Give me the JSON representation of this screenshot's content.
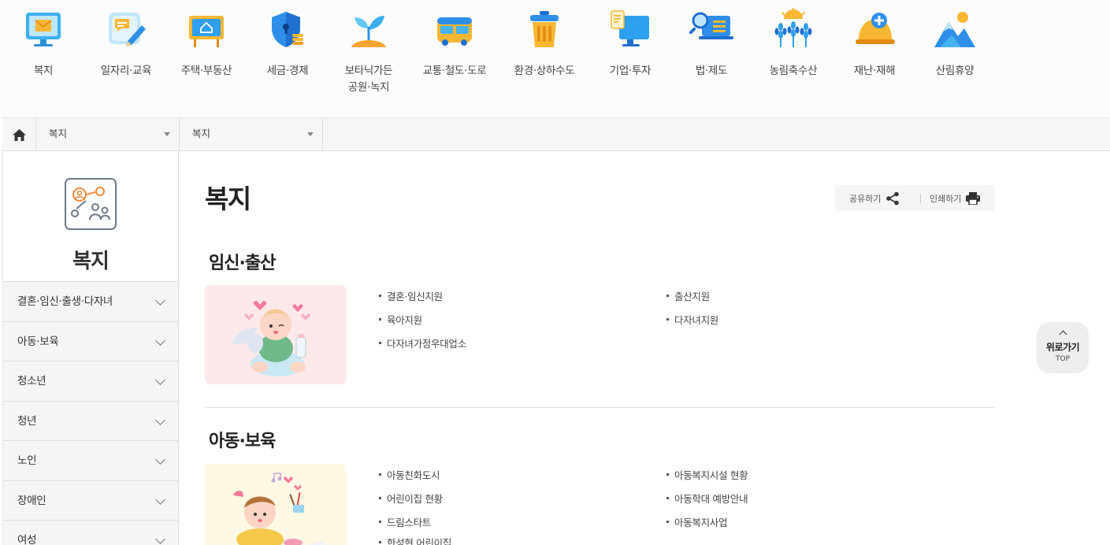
{
  "categories": [
    {
      "label": "복지",
      "icon": "monitor-mail-icon"
    },
    {
      "label": "일자리·교육",
      "icon": "chat-pencil-icon"
    },
    {
      "label": "주택·부동산",
      "icon": "house-sign-icon"
    },
    {
      "label": "세금·경제",
      "icon": "shield-coin-icon"
    },
    {
      "label": "보타닉가든\n공원·녹지",
      "icon": "sprout-icon"
    },
    {
      "label": "교통·철도·도로",
      "icon": "bus-icon"
    },
    {
      "label": "환경·상하수도",
      "icon": "trash-can-icon"
    },
    {
      "label": "기업·투자",
      "icon": "monitor-document-icon"
    },
    {
      "label": "법·제도",
      "icon": "magnifier-laptop-icon"
    },
    {
      "label": "농림축수산",
      "icon": "wheat-sun-icon"
    },
    {
      "label": "재난·재해",
      "icon": "helmet-cross-icon"
    },
    {
      "label": "산림휴양",
      "icon": "mountain-icon"
    }
  ],
  "breadcrumb": {
    "home_icon": "home-icon",
    "level1": "복지",
    "level2": "복지"
  },
  "sidebar": {
    "title": "복지",
    "icon": "welfare-people-icon",
    "items": [
      {
        "label": "결혼·임신·출생·다자녀"
      },
      {
        "label": "아동·보육"
      },
      {
        "label": "청소년"
      },
      {
        "label": "청년"
      },
      {
        "label": "노인"
      },
      {
        "label": "장애인"
      },
      {
        "label": "여성"
      }
    ]
  },
  "main": {
    "title": "복지",
    "share_label": "공유하기",
    "print_label": "인쇄하기",
    "sections": [
      {
        "title": "임신·출산",
        "links": [
          "결혼·임신지원",
          "출산지원",
          "육아지원",
          "다자녀지원",
          "다자녀가정우대업소"
        ]
      },
      {
        "title": "아동·보육",
        "links": [
          "아동친화도시",
          "아동복지시설 현황",
          "어린이집 현황",
          "아동학대 예방안내",
          "드림스타트",
          "아동복지사업",
          "한성현 어린이집"
        ]
      }
    ]
  },
  "top_button": {
    "label": "위로가기",
    "sub": "TOP"
  },
  "colors": {
    "accent_blue": "#2f8fe8",
    "accent_orange": "#f7a531",
    "pink_bg": "#fde9ea",
    "yellow_bg": "#fff8e3"
  }
}
